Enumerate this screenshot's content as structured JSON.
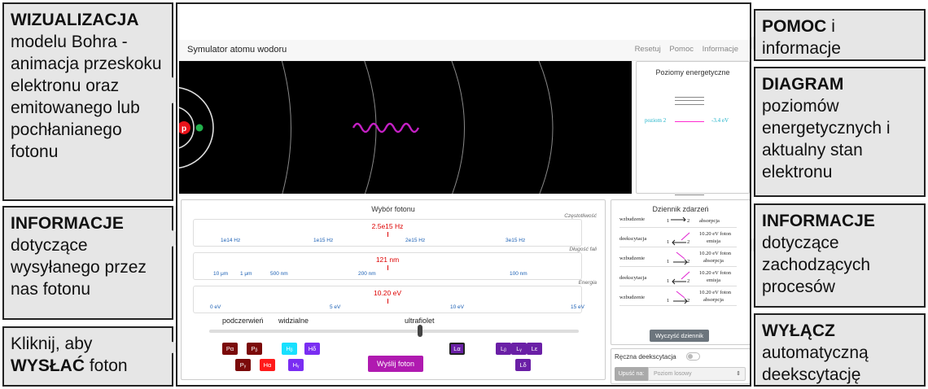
{
  "callouts": {
    "viz": {
      "bold": "WIZUALIZACJA",
      "text": "modelu Bohra - animacja przeskoku elektronu oraz emitowanego lub pochłanianego fotonu"
    },
    "info_photon": {
      "bold": "INFORMACJE",
      "text": "dotyczące wysyłanego przez nas fotonu"
    },
    "click": {
      "pre": "Kliknij, aby",
      "bold": "WYSŁAĆ",
      "post": "foton"
    },
    "help": {
      "bold": "POMOC",
      "post": "i informacje"
    },
    "diagram": {
      "bold": "DIAGRAM",
      "text": "poziomów energetycznych i aktualny stan elektronu"
    },
    "info_proc": {
      "bold": "INFORMACJE",
      "text": "dotyczące zachodzących procesów"
    },
    "off": {
      "bold": "WYŁĄCZ",
      "text": "automatyczną deekscytację"
    }
  },
  "nav": {
    "title": "Symulator atomu wodoru",
    "links": [
      "Resetuj",
      "Pomoc",
      "Informacje"
    ]
  },
  "atom": {
    "proton_label": "p"
  },
  "energy": {
    "title": "Poziomy energetyczne",
    "level_label": "poziom 2",
    "energy_value": "-3.4 eV"
  },
  "photon": {
    "title": "Wybór fotonu",
    "freq": {
      "label": "Częstotliwość",
      "value": "2.5e15 Hz",
      "ticks": [
        "1e14 Hz",
        "1e15 Hz",
        "2e15 Hz",
        "3e15 Hz"
      ]
    },
    "wave": {
      "label": "Długość fali",
      "value": "121 nm",
      "ticks": [
        "10 μm",
        "1 μm",
        "500 nm",
        "200 nm",
        "100 nm"
      ]
    },
    "energy": {
      "label": "Energia",
      "value": "10.20 eV",
      "ticks": [
        "0 eV",
        "5 eV",
        "10 eV",
        "15 eV"
      ]
    },
    "ranges": [
      "podczerwień",
      "widzialne",
      "ultrafiolet"
    ],
    "slider_value": 0.57,
    "send": "Wyślij foton",
    "lines": {
      "pa": "Pα",
      "pb": "Pᵦ",
      "pg": "Pᵧ",
      "pd": "Pδ",
      "ha": "Hα",
      "hb": "Hᵦ",
      "hg": "Hᵧ",
      "hd": "Hδ",
      "la": "Lα",
      "lb": "Lᵦ",
      "lg": "Lᵧ",
      "le": "Lε",
      "ld": "Lδ"
    },
    "colors": {
      "paschen": "#7b0a0a",
      "balmer_red": "#ff1a1a",
      "balmer_cyan": "#18e0ff",
      "balmer_violet": "#7a2df2",
      "lyman": "#6a1fa6",
      "send": "#b01ab0"
    }
  },
  "log": {
    "title": "Dziennik zdarzeń",
    "entries": [
      {
        "type": "wzbudzenie",
        "from": "1",
        "to": "2",
        "desc1": "",
        "desc2": "absorpcja"
      },
      {
        "type": "deekscytacja",
        "from": "1",
        "to": "2",
        "desc1": "10.20 eV foton",
        "desc2": "emisja"
      },
      {
        "type": "wzbudzenie",
        "from": "1",
        "to": "2",
        "desc1": "10.20 eV foton",
        "desc2": "absorpcja"
      },
      {
        "type": "deekscytacja",
        "from": "1",
        "to": "2",
        "desc1": "10.20 eV foton",
        "desc2": "emisja"
      },
      {
        "type": "wzbudzenie",
        "from": "1",
        "to": "2",
        "desc1": "10.20 eV foton",
        "desc2": "absorpcja"
      }
    ],
    "clear": "Wyczyść dziennik"
  },
  "manual": {
    "label": "Ręczna deekscytacja",
    "drop_label": "Upuść na:",
    "select": "Poziom losowy"
  }
}
